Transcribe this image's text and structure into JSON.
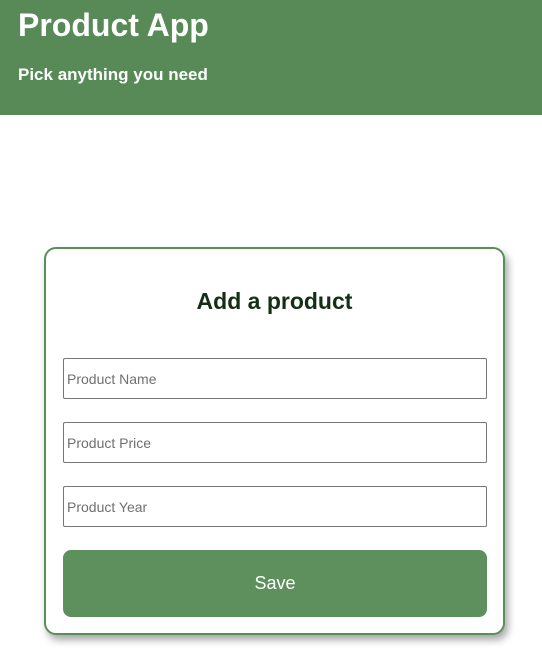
{
  "header": {
    "title": "Product App",
    "subtitle": "Pick anything you need"
  },
  "form": {
    "title": "Add a product",
    "fields": [
      {
        "placeholder": "Product Name",
        "value": ""
      },
      {
        "placeholder": "Product Price",
        "value": ""
      },
      {
        "placeholder": "Product Year",
        "value": ""
      }
    ],
    "save_label": "Save"
  },
  "colors": {
    "header_bg": "#578a57",
    "accent": "#5e905e",
    "card_border": "#5a8f5a",
    "card_title": "#143014"
  }
}
